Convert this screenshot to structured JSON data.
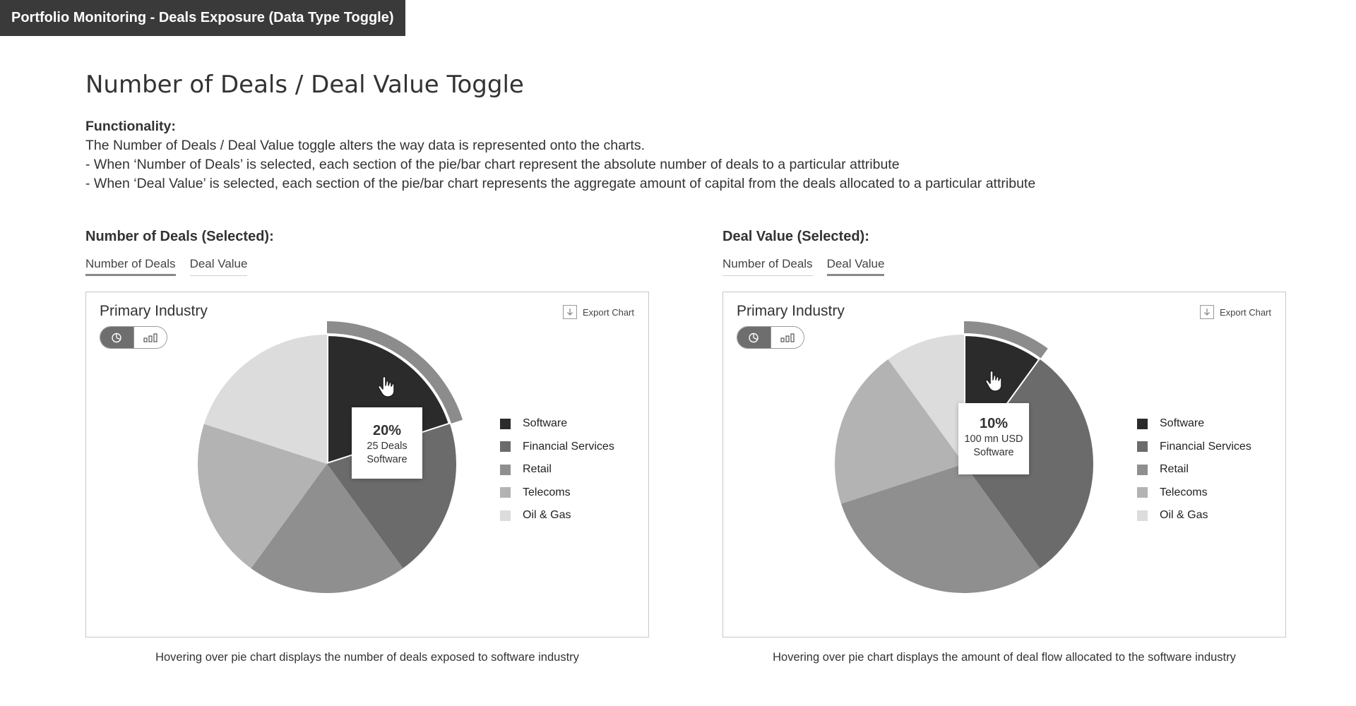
{
  "window": {
    "title": "Portfolio Monitoring - Deals Exposure (Data Type Toggle)"
  },
  "page": {
    "heading": "Number of Deals / Deal Value Toggle",
    "functionality_title": "Functionality:",
    "functionality_lines": [
      "The Number of Deals / Deal Value toggle alters the way data is represented onto the charts.",
      "- When ‘Number of Deals’ is selected, each section of the pie/bar chart represent the absolute number of deals to a particular attribute",
      "- When ‘Deal Value’ is selected, each section of the pie/bar chart represents the aggregate amount of capital from the deals allocated to a particular attribute"
    ]
  },
  "examples": [
    {
      "section_title": "Number of Deals (Selected):",
      "tabs": [
        {
          "label": "Number of Deals",
          "active": true
        },
        {
          "label": "Deal Value",
          "active": false
        }
      ],
      "panel_title": "Primary Industry",
      "export_label": "Export Chart",
      "chart_type_toggle": {
        "selected": "pie",
        "options": [
          "pie-chart-icon",
          "bar-chart-icon"
        ]
      },
      "tooltip": {
        "percent": "20%",
        "line1": "25 Deals",
        "line2": "Software"
      },
      "caption": "Hovering over pie chart displays the number of deals exposed to software industry"
    },
    {
      "section_title": "Deal Value (Selected):",
      "tabs": [
        {
          "label": "Number of Deals",
          "active": false
        },
        {
          "label": "Deal Value",
          "active": true
        }
      ],
      "panel_title": "Primary Industry",
      "export_label": "Export Chart",
      "chart_type_toggle": {
        "selected": "pie",
        "options": [
          "pie-chart-icon",
          "bar-chart-icon"
        ]
      },
      "tooltip": {
        "percent": "10%",
        "line1": "100 mn USD",
        "line2": "Software"
      },
      "caption": "Hovering over pie chart displays the amount of deal flow allocated to the software industry"
    }
  ],
  "chart_data": [
    {
      "type": "pie",
      "title": "Primary Industry",
      "categories": [
        "Software",
        "Financial Services",
        "Retail",
        "Telecoms",
        "Oil & Gas"
      ],
      "values": [
        20,
        20,
        20,
        20,
        20
      ],
      "colors": [
        "#2b2b2b",
        "#6b6b6b",
        "#8f8f8f",
        "#b3b3b3",
        "#dcdcdc"
      ],
      "highlighted": "Software",
      "legend": "right"
    },
    {
      "type": "pie",
      "title": "Primary Industry",
      "categories": [
        "Software",
        "Financial Services",
        "Retail",
        "Telecoms",
        "Oil & Gas"
      ],
      "values": [
        10,
        30,
        30,
        20,
        10
      ],
      "colors": [
        "#2b2b2b",
        "#6b6b6b",
        "#8f8f8f",
        "#b3b3b3",
        "#dcdcdc"
      ],
      "highlighted": "Software",
      "legend": "right"
    }
  ]
}
